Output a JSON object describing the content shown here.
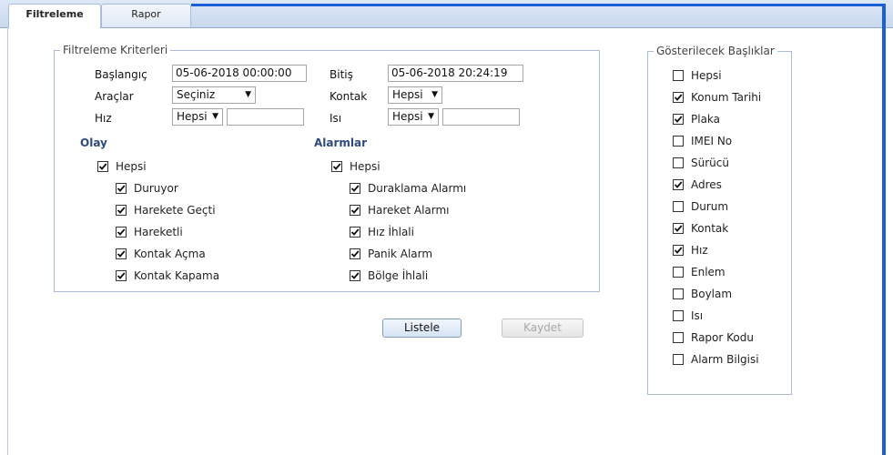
{
  "tabs": [
    {
      "label": "Filtreleme",
      "active": true
    },
    {
      "label": "Rapor",
      "active": false
    }
  ],
  "filter": {
    "legend": "Filtreleme Kriterleri",
    "start_label": "Başlangıç",
    "start_value": "05-06-2018 00:00:00",
    "end_label": "Bitiş",
    "end_value": "05-06-2018 20:24:19",
    "vehicles_label": "Araçlar",
    "vehicles_value": "Seçiniz",
    "contact_label": "Kontak",
    "contact_value": "Hepsi",
    "speed_label": "Hız",
    "speed_value": "Hepsi",
    "speed_input": "",
    "temp_label": "Isı",
    "temp_value": "Hepsi",
    "temp_input": ""
  },
  "events": {
    "title": "Olay",
    "all": {
      "label": "Hepsi",
      "checked": true
    },
    "items": [
      {
        "label": "Duruyor",
        "checked": true
      },
      {
        "label": "Harekete Geçti",
        "checked": true
      },
      {
        "label": "Hareketli",
        "checked": true
      },
      {
        "label": "Kontak Açma",
        "checked": true
      },
      {
        "label": "Kontak Kapama",
        "checked": true
      }
    ]
  },
  "alarms": {
    "title": "Alarmlar",
    "all": {
      "label": "Hepsi",
      "checked": true
    },
    "items": [
      {
        "label": "Duraklama Alarmı",
        "checked": true
      },
      {
        "label": "Hareket Alarmı",
        "checked": true
      },
      {
        "label": "Hız İhlali",
        "checked": true
      },
      {
        "label": "Panik Alarm",
        "checked": true
      },
      {
        "label": "Bölge İhlali",
        "checked": true
      }
    ]
  },
  "buttons": {
    "list_label": "Listele",
    "save_label": "Kaydet"
  },
  "columns": {
    "legend": "Gösterilecek Başlıklar",
    "items": [
      {
        "label": "Hepsi",
        "checked": false
      },
      {
        "label": "Konum Tarihi",
        "checked": true
      },
      {
        "label": "Plaka",
        "checked": true
      },
      {
        "label": "IMEI No",
        "checked": false
      },
      {
        "label": "Sürücü",
        "checked": false
      },
      {
        "label": "Adres",
        "checked": true
      },
      {
        "label": "Durum",
        "checked": false
      },
      {
        "label": "Kontak",
        "checked": true
      },
      {
        "label": "Hız",
        "checked": true
      },
      {
        "label": "Enlem",
        "checked": false
      },
      {
        "label": "Boylam",
        "checked": false
      },
      {
        "label": "Isı",
        "checked": false
      },
      {
        "label": "Rapor Kodu",
        "checked": false
      },
      {
        "label": "Alarm Bilgisi",
        "checked": false
      }
    ]
  },
  "colors": {
    "accent": "#1a5fd6",
    "section_title": "#2e4a7a"
  },
  "icons": {
    "checkbox_checked": "checkmark-icon",
    "dropdown": "chevron-down-icon"
  }
}
